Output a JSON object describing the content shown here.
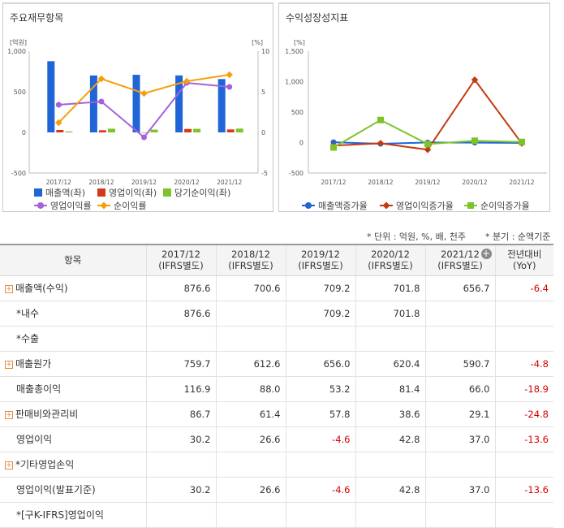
{
  "left_panel": {
    "title": "주요재무항목",
    "left_unit": "[억원]",
    "right_unit": "[%]",
    "legend": [
      {
        "label": "매출액(좌)",
        "color": "#2065d8",
        "marker": "bar"
      },
      {
        "label": "영업이익(좌)",
        "color": "#d43a1a",
        "marker": "bar"
      },
      {
        "label": "당기순이익(좌)",
        "color": "#7dc42a",
        "marker": "bar"
      },
      {
        "label": "영업이익률",
        "color": "#a461d8",
        "marker": "circle"
      },
      {
        "label": "순이익률",
        "color": "#f5a00a",
        "marker": "diamond"
      }
    ]
  },
  "right_panel": {
    "title": "수익성장성지표",
    "unit": "[%]",
    "legend": [
      {
        "label": "매출액증가율",
        "color": "#2065d8",
        "marker": "circle"
      },
      {
        "label": "영업이익증가율",
        "color": "#c43a10",
        "marker": "diamond"
      },
      {
        "label": "순이익증가율",
        "color": "#7dc42a",
        "marker": "square"
      }
    ]
  },
  "chart_data": [
    {
      "type": "bar",
      "title": "주요재무항목",
      "categories": [
        "2017/12",
        "2018/12",
        "2019/12",
        "2020/12",
        "2021/12"
      ],
      "ylim": [
        -500,
        1000
      ],
      "yticks": [
        "1,000",
        "500",
        "0",
        "-500"
      ],
      "y2lim": [
        -5,
        10
      ],
      "y2ticks": [
        "10",
        "5",
        "0",
        "-5"
      ],
      "series": [
        {
          "name": "매출액(좌)",
          "axis": "left",
          "type": "bar",
          "color": "#2065d8",
          "values": [
            876.6,
            700.6,
            709.2,
            701.8,
            656.7
          ]
        },
        {
          "name": "영업이익(좌)",
          "axis": "left",
          "type": "bar",
          "color": "#d43a1a",
          "values": [
            30.2,
            26.6,
            -4.6,
            42.8,
            37.0
          ]
        },
        {
          "name": "당기순이익(좌)",
          "axis": "left",
          "type": "bar",
          "color": "#7dc42a",
          "values": [
            12,
            46,
            34,
            44,
            47
          ]
        },
        {
          "name": "영업이익률",
          "axis": "right",
          "type": "line",
          "color": "#a461d8",
          "values": [
            3.4,
            3.8,
            -0.6,
            6.1,
            5.6
          ]
        },
        {
          "name": "순이익률",
          "axis": "right",
          "type": "line",
          "color": "#f5a00a",
          "values": [
            1.2,
            6.6,
            4.8,
            6.3,
            7.1
          ]
        }
      ]
    },
    {
      "type": "line",
      "title": "수익성장성지표",
      "categories": [
        "2017/12",
        "2018/12",
        "2019/12",
        "2020/12",
        "2021/12"
      ],
      "ylim": [
        -500,
        1500
      ],
      "yticks": [
        "1,500",
        "1,000",
        "500",
        "0",
        "-500"
      ],
      "series": [
        {
          "name": "매출액증가율",
          "color": "#2065d8",
          "values": [
            5,
            -20,
            1,
            -1,
            -6
          ]
        },
        {
          "name": "영업이익증가율",
          "color": "#c43a10",
          "values": [
            -50,
            -12,
            -117,
            1030,
            -14
          ]
        },
        {
          "name": "순이익증가율",
          "color": "#7dc42a",
          "values": [
            -80,
            370,
            -25,
            30,
            10
          ]
        }
      ]
    }
  ],
  "notes": {
    "unit": "* 단위 : 억원, %, 배, 천주",
    "quarter": "* 분기 : 순액기준"
  },
  "table": {
    "headers": [
      {
        "line1": "항목",
        "line2": ""
      },
      {
        "line1": "2017/12",
        "line2": "(IFRS별도)"
      },
      {
        "line1": "2018/12",
        "line2": "(IFRS별도)"
      },
      {
        "line1": "2019/12",
        "line2": "(IFRS별도)"
      },
      {
        "line1": "2020/12",
        "line2": "(IFRS별도)"
      },
      {
        "line1": "2021/12",
        "line2": "(IFRS별도)"
      },
      {
        "line1": "전년대비",
        "line2": "(YoY)"
      }
    ],
    "expand_icon": "+",
    "rows": [
      {
        "label": "매출액(수익)",
        "expandable": true,
        "values": [
          "876.6",
          "700.6",
          "709.2",
          "701.8",
          "656.7",
          "-6.4"
        ]
      },
      {
        "label": "*내수",
        "expandable": false,
        "values": [
          "876.6",
          "",
          "709.2",
          "701.8",
          "",
          ""
        ]
      },
      {
        "label": "*수출",
        "expandable": false,
        "values": [
          "",
          "",
          "",
          "",
          "",
          ""
        ]
      },
      {
        "label": "매출원가",
        "expandable": true,
        "values": [
          "759.7",
          "612.6",
          "656.0",
          "620.4",
          "590.7",
          "-4.8"
        ]
      },
      {
        "label": "매출총이익",
        "expandable": false,
        "values": [
          "116.9",
          "88.0",
          "53.2",
          "81.4",
          "66.0",
          "-18.9"
        ]
      },
      {
        "label": "판매비와관리비",
        "expandable": true,
        "values": [
          "86.7",
          "61.4",
          "57.8",
          "38.6",
          "29.1",
          "-24.8"
        ]
      },
      {
        "label": "영업이익",
        "expandable": false,
        "values": [
          "30.2",
          "26.6",
          "-4.6",
          "42.8",
          "37.0",
          "-13.6"
        ]
      },
      {
        "label": "*기타영업손익",
        "expandable": true,
        "values": [
          "",
          "",
          "",
          "",
          "",
          ""
        ]
      },
      {
        "label": "영업이익(발표기준)",
        "expandable": false,
        "values": [
          "30.2",
          "26.6",
          "-4.6",
          "42.8",
          "37.0",
          "-13.6"
        ]
      },
      {
        "label": "*[구K-IFRS]영업이익",
        "expandable": false,
        "values": [
          "",
          "",
          "",
          "",
          "",
          ""
        ]
      }
    ]
  }
}
